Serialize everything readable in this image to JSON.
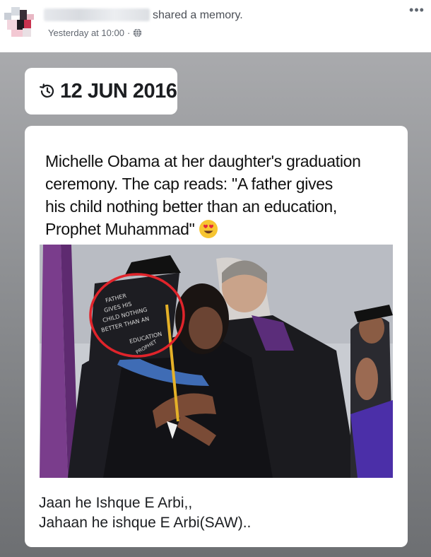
{
  "post": {
    "action_text": "shared a memory.",
    "timestamp": "Yesterday at 10:00",
    "separator": "·",
    "privacy_icon": "globe-icon",
    "more_label": "•••"
  },
  "memory": {
    "date": "12 JUN 2016",
    "date_icon": "history-icon",
    "caption": {
      "line1": "Michelle Obama at her daughter's graduation",
      "line2": "ceremony. The cap reads: \"A father gives",
      "line3": "his child nothing better than an education,",
      "line4": "Prophet Muhammad\""
    },
    "caption_emoji": "heart-eyes-emoji",
    "photo_description_icon": "graduation-photo",
    "body": {
      "line1": "Jaan he Ishque E Arbi,,",
      "line2": "Jahaan he ishque E Arbi(SAW).."
    }
  },
  "colors": {
    "background_gray": "#8d8f92",
    "highlight_circle": "#e0242b",
    "text": "#1c1e21"
  }
}
